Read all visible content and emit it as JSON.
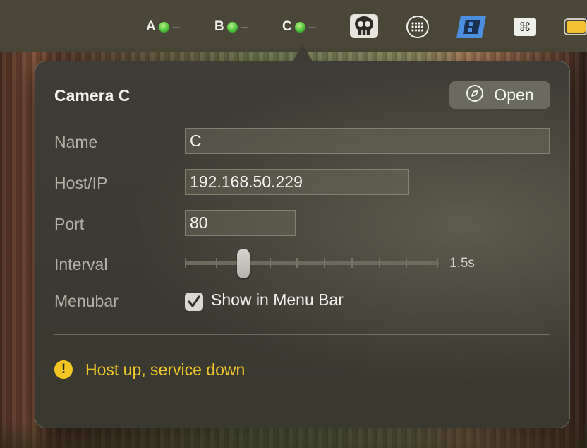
{
  "menubar": {
    "status_items": [
      {
        "letter": "A",
        "dash": "–"
      },
      {
        "letter": "B",
        "dash": "–"
      },
      {
        "letter": "C",
        "dash": "–"
      }
    ],
    "icons": [
      "skull-app-icon",
      "grid-dots-icon",
      "blue-window-app-icon",
      "command-key-icon",
      "battery-icon"
    ],
    "status_color": "#4cc43a"
  },
  "popover": {
    "title": "Camera C",
    "open_button": {
      "label": "Open",
      "icon": "compass-icon"
    },
    "fields": {
      "name": {
        "label": "Name",
        "value": "C"
      },
      "host": {
        "label": "Host/IP",
        "value": "192.168.50.229"
      },
      "port": {
        "label": "Port",
        "value": "80"
      }
    },
    "interval": {
      "label": "Interval",
      "value_text": "1.5s",
      "position_index": 2,
      "tick_count": 10
    },
    "menubar_option": {
      "label": "Menubar",
      "checkbox_label": "Show in Menu Bar",
      "checked": true
    },
    "status": {
      "icon": "warning-icon",
      "symbol": "!",
      "message": "Host up, service down",
      "color": "#f0c52a"
    }
  }
}
